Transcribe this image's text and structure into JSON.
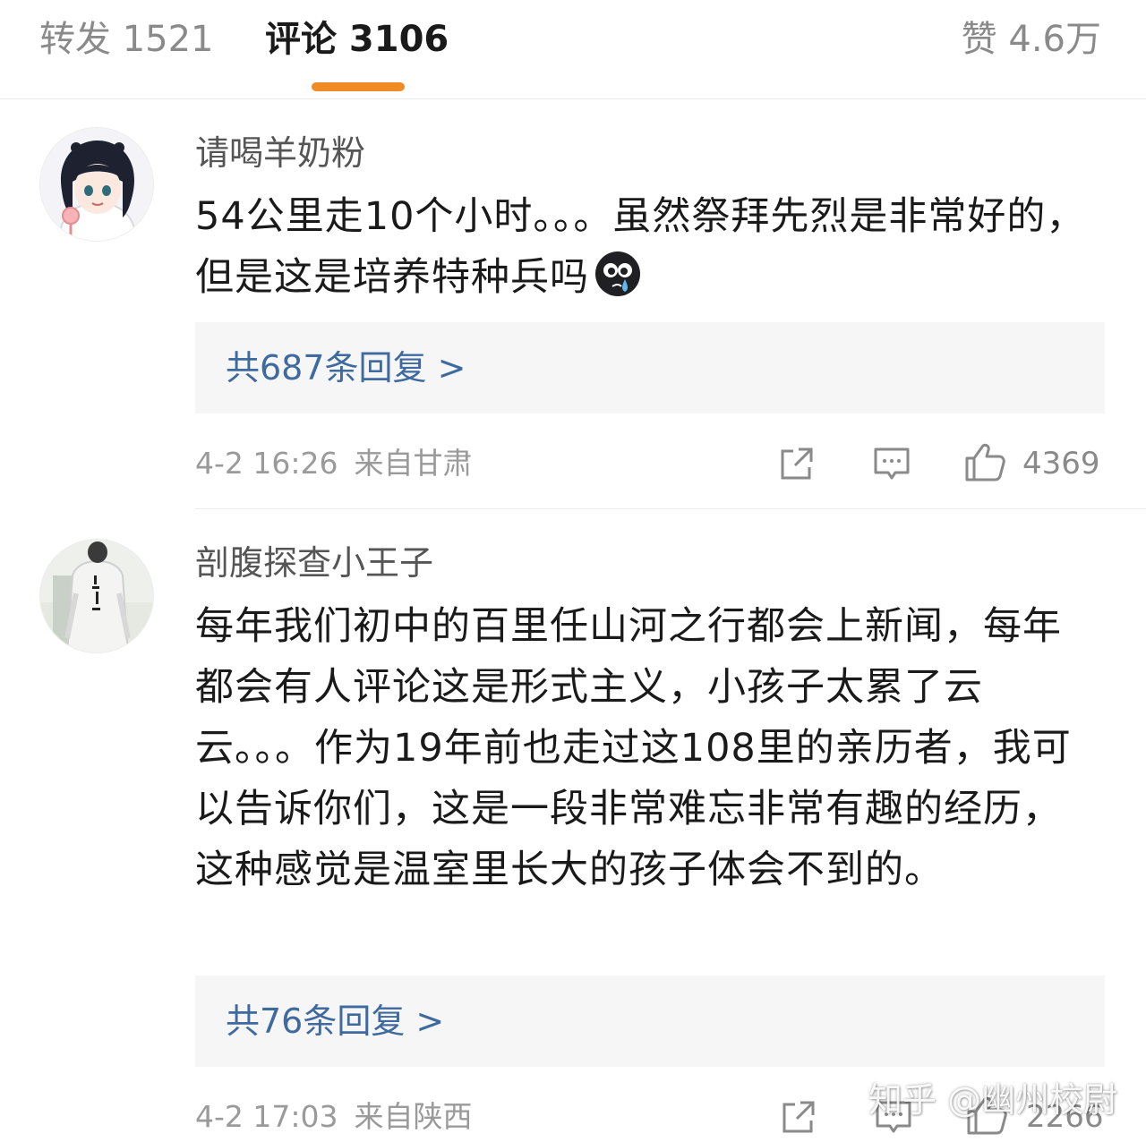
{
  "tabs": {
    "repost_label": "转发 1521",
    "comment_label": "评论 3106",
    "like_label": "赞 4.6万",
    "accent_color": "#f08a24"
  },
  "comments": [
    {
      "username": "请喝羊奶粉",
      "text": "54公里走10个小时。。。虽然祭拜先烈是非常好的，但是这是培养特种兵吗",
      "emoji_icon": "crying-face-icon",
      "replies_label": "共687条回复 >",
      "date": "4-2 16:26",
      "location": "来自甘肃",
      "likes": "4369"
    },
    {
      "username": "剖腹探查小王子",
      "text": "每年我们初中的百里任山河之行都会上新闻，每年都会有人评论这是形式主义，小孩子太累了云云。。。作为19年前也走过这108里的亲历者，我可以告诉你们，这是一段非常难忘非常有趣的经历，这种感觉是温室里长大的孩子体会不到的。",
      "replies_label": "共76条回复 >",
      "date": "4-2 17:03",
      "location": "来自陕西",
      "likes": "2266"
    }
  ],
  "watermark": "知乎 @幽州校尉"
}
